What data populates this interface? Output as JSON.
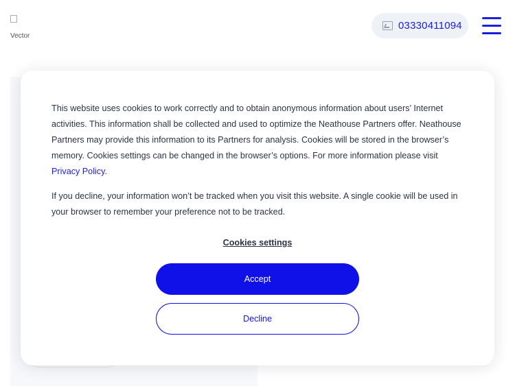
{
  "header": {
    "logo_alt": "Vector",
    "phone_number": "03330411094"
  },
  "cookie_modal": {
    "paragraph1_text": "This website uses cookies to work correctly and to obtain anonymous information about users’ Internet activities. This information shall be collected and used to optimize the Neathouse Partners offer. Neathouse Partners may provide this information to its Partners for analysis. Cookies will be stored in the browser’s memory. Cookies settings can be changed in the browser’s options. For more information please visit ",
    "privacy_link": "Privacy Policy.",
    "paragraph2_text": "If you decline, your information won’t be tracked when you visit this website. A single cookie will be used in your browser to remember your preference not to be tracked.",
    "settings_link": "Cookies settings",
    "accept_label": "Accept",
    "decline_label": "Decline"
  },
  "colors": {
    "brand_blue": "#0f11e8",
    "phone_pill_bg": "#eef1f6",
    "text": "#2a3346"
  }
}
